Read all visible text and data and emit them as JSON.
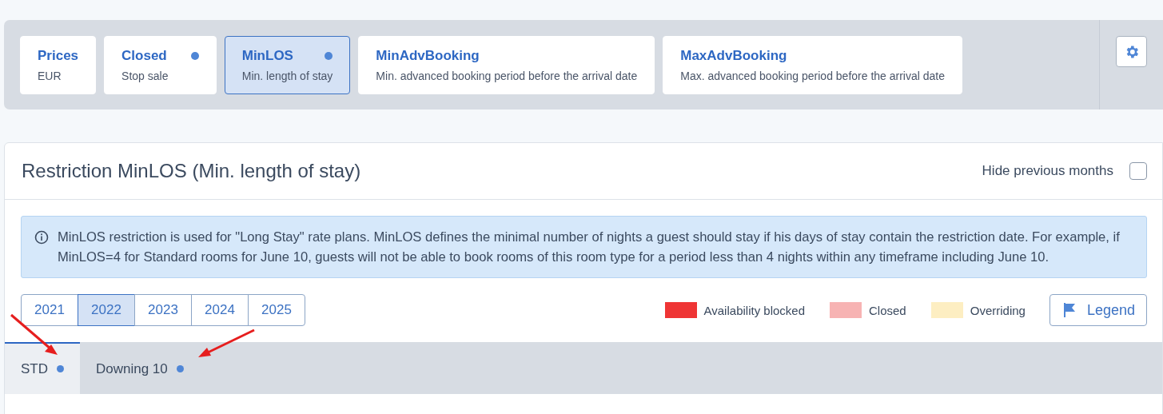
{
  "restriction_tabs": [
    {
      "title": "Prices",
      "subtitle": "EUR",
      "dot": false,
      "selected": false
    },
    {
      "title": "Closed",
      "subtitle": "Stop sale",
      "dot": true,
      "selected": false
    },
    {
      "title": "MinLOS",
      "subtitle": "Min. length of stay",
      "dot": true,
      "selected": true
    },
    {
      "title": "MinAdvBooking",
      "subtitle": "Min. advanced booking period before the arrival date",
      "dot": false,
      "selected": false
    },
    {
      "title": "MaxAdvBooking",
      "subtitle": "Max. advanced booking period before the arrival date",
      "dot": false,
      "selected": false
    }
  ],
  "panel": {
    "title": "Restriction MinLOS (Min. length of stay)",
    "hide_previous_months": {
      "label": "Hide previous months",
      "checked": false
    },
    "info": "MinLOS restriction is used for \"Long Stay\" rate plans. MinLOS defines the minimal number of nights a guest should stay if his days of stay contain the restriction date. For example, if MinLOS=4 for Standard rooms for June 10, guests will not be able to book rooms of this room type for a period less than 4 nights within any timeframe including June 10.",
    "years": [
      {
        "label": "2021",
        "selected": false
      },
      {
        "label": "2022",
        "selected": true
      },
      {
        "label": "2023",
        "selected": false
      },
      {
        "label": "2024",
        "selected": false
      },
      {
        "label": "2025",
        "selected": false
      }
    ],
    "legend": [
      {
        "label": "Availability blocked",
        "color": "#ef3535"
      },
      {
        "label": "Closed",
        "color": "#f7b3b3"
      },
      {
        "label": "Overriding",
        "color": "#fdeec2"
      }
    ],
    "legend_button": "Legend",
    "room_tabs": [
      {
        "label": "STD",
        "dot": true,
        "selected": true
      },
      {
        "label": "Downing 10",
        "dot": true,
        "selected": false
      }
    ]
  }
}
